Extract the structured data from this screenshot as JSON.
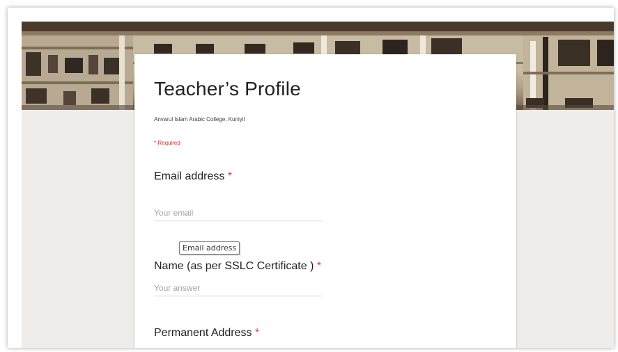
{
  "colors": {
    "page_background": "#eeedeb",
    "card_background": "#ffffff",
    "required_red": "#db4437"
  },
  "form": {
    "title": "Teacher’s Profile",
    "description": "Anvarul Islam Arabic College, Kuniyil",
    "required_note": "* Required",
    "required_marker": "*",
    "questions": [
      {
        "label": "Email address",
        "placeholder": "Your email",
        "tooltip": "Email address"
      },
      {
        "label": "Name (as per SSLC Certificate )",
        "placeholder": "Your answer"
      },
      {
        "label": "Permanent Address"
      }
    ]
  }
}
